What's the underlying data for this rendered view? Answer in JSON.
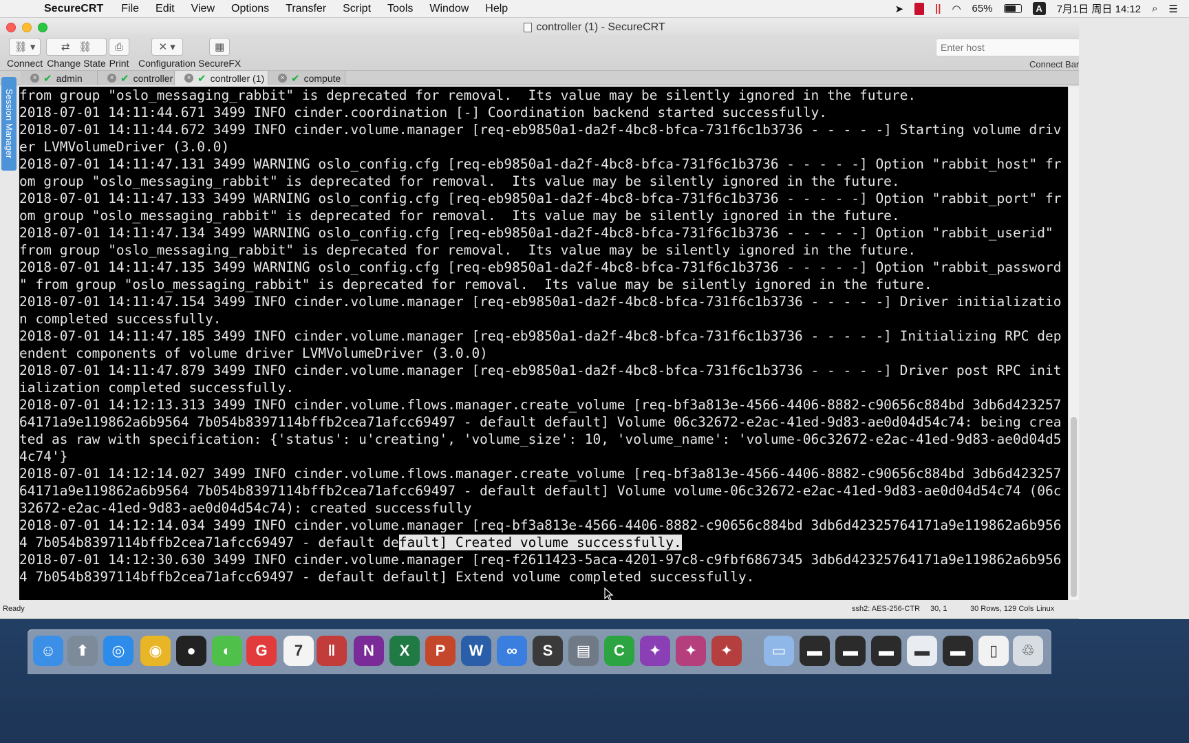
{
  "menubar": {
    "app_name": "SecureCRT",
    "items": [
      "File",
      "Edit",
      "View",
      "Options",
      "Transfer",
      "Script",
      "Tools",
      "Window",
      "Help"
    ],
    "battery": "65%",
    "ime": "A",
    "clock": "7月1日 周日 14:12"
  },
  "window": {
    "title": "controller (1) - SecureCRT"
  },
  "toolbar": {
    "connect": "Connect",
    "change_state": "Change State",
    "print": "Print",
    "configuration": "Configuration",
    "securefx": "SecureFX",
    "host_placeholder": "Enter host",
    "connect_bar": "Connect Bar"
  },
  "tabs": [
    {
      "label": "admin",
      "active": false
    },
    {
      "label": "controller",
      "active": false
    },
    {
      "label": "controller (1)",
      "active": true
    },
    {
      "label": "compute",
      "active": false
    }
  ],
  "session_manager": "Session Manager",
  "terminal": {
    "lines": [
      "from group \"oslo_messaging_rabbit\" is deprecated for removal.  Its value may be silently ignored in the future.",
      "2018-07-01 14:11:44.671 3499 INFO cinder.coordination [-] Coordination backend started successfully.",
      "2018-07-01 14:11:44.672 3499 INFO cinder.volume.manager [req-eb9850a1-da2f-4bc8-bfca-731f6c1b3736 - - - - -] Starting volume driv",
      "er LVMVolumeDriver (3.0.0)",
      "2018-07-01 14:11:47.131 3499 WARNING oslo_config.cfg [req-eb9850a1-da2f-4bc8-bfca-731f6c1b3736 - - - - -] Option \"rabbit_host\" fr",
      "om group \"oslo_messaging_rabbit\" is deprecated for removal.  Its value may be silently ignored in the future.",
      "2018-07-01 14:11:47.133 3499 WARNING oslo_config.cfg [req-eb9850a1-da2f-4bc8-bfca-731f6c1b3736 - - - - -] Option \"rabbit_port\" fr",
      "om group \"oslo_messaging_rabbit\" is deprecated for removal.  Its value may be silently ignored in the future.",
      "2018-07-01 14:11:47.134 3499 WARNING oslo_config.cfg [req-eb9850a1-da2f-4bc8-bfca-731f6c1b3736 - - - - -] Option \"rabbit_userid\"",
      "from group \"oslo_messaging_rabbit\" is deprecated for removal.  Its value may be silently ignored in the future.",
      "2018-07-01 14:11:47.135 3499 WARNING oslo_config.cfg [req-eb9850a1-da2f-4bc8-bfca-731f6c1b3736 - - - - -] Option \"rabbit_password",
      "\" from group \"oslo_messaging_rabbit\" is deprecated for removal.  Its value may be silently ignored in the future.",
      "2018-07-01 14:11:47.154 3499 INFO cinder.volume.manager [req-eb9850a1-da2f-4bc8-bfca-731f6c1b3736 - - - - -] Driver initializatio",
      "n completed successfully.",
      "2018-07-01 14:11:47.185 3499 INFO cinder.volume.manager [req-eb9850a1-da2f-4bc8-bfca-731f6c1b3736 - - - - -] Initializing RPC dep",
      "endent components of volume driver LVMVolumeDriver (3.0.0)",
      "2018-07-01 14:11:47.879 3499 INFO cinder.volume.manager [req-eb9850a1-da2f-4bc8-bfca-731f6c1b3736 - - - - -] Driver post RPC init",
      "ialization completed successfully.",
      "2018-07-01 14:12:13.313 3499 INFO cinder.volume.flows.manager.create_volume [req-bf3a813e-4566-4406-8882-c90656c884bd 3db6d423257",
      "64171a9e119862a6b9564 7b054b8397114bffb2cea71afcc69497 - default default] Volume 06c32672-e2ac-41ed-9d83-ae0d04d54c74: being crea",
      "ted as raw with specification: {'status': u'creating', 'volume_size': 10, 'volume_name': 'volume-06c32672-e2ac-41ed-9d83-ae0d04d5",
      "4c74'}",
      "2018-07-01 14:12:14.027 3499 INFO cinder.volume.flows.manager.create_volume [req-bf3a813e-4566-4406-8882-c90656c884bd 3db6d423257",
      "64171a9e119862a6b9564 7b054b8397114bffb2cea71afcc69497 - default default] Volume volume-06c32672-e2ac-41ed-9d83-ae0d04d54c74 (06c",
      "32672-e2ac-41ed-9d83-ae0d04d54c74): created successfully",
      "2018-07-01 14:12:14.034 3499 INFO cinder.volume.manager [req-bf3a813e-4566-4406-8882-c90656c884bd 3db6d42325764171a9e119862a6b956"
    ],
    "sel_line_pre": "4 7b054b8397114bffb2cea71afcc69497 - default de",
    "sel_line_sel": "fault] Created volume successfully.",
    "tail_lines": [
      "2018-07-01 14:12:30.630 3499 INFO cinder.volume.manager [req-f2611423-5aca-4201-97c8-c9fbf6867345 3db6d42325764171a9e119862a6b956",
      "4 7b054b8397114bffb2cea71afcc69497 - default default] Extend volume completed successfully."
    ]
  },
  "status": {
    "ready": "Ready",
    "cipher": "ssh2: AES-256-CTR",
    "position": "30, 1",
    "size": "30 Rows, 129 Cols",
    "term": "Linux"
  },
  "dock": {
    "apps": [
      {
        "name": "finder",
        "color": "#3b8fe6",
        "glyph": "☺"
      },
      {
        "name": "launchpad",
        "color": "#7d8a99",
        "glyph": "⬆"
      },
      {
        "name": "safari",
        "color": "#2d8bea",
        "glyph": "◎"
      },
      {
        "name": "chrome",
        "color": "#e8b526",
        "glyph": "◉"
      },
      {
        "name": "qq",
        "color": "#222222",
        "glyph": "●"
      },
      {
        "name": "wechat",
        "color": "#4fc14a",
        "glyph": "◐"
      },
      {
        "name": "g-app",
        "color": "#e23b3b",
        "glyph": "G"
      },
      {
        "name": "calendar",
        "color": "#f4f4f4",
        "glyph": "7"
      },
      {
        "name": "parallels",
        "color": "#c33c3c",
        "glyph": "‖"
      },
      {
        "name": "onenote",
        "color": "#7b2b97",
        "glyph": "N"
      },
      {
        "name": "excel",
        "color": "#1f7a44",
        "glyph": "X"
      },
      {
        "name": "powerpoint",
        "color": "#c4472b",
        "glyph": "P"
      },
      {
        "name": "word",
        "color": "#2b5ea8",
        "glyph": "W"
      },
      {
        "name": "baidu-netdisk",
        "color": "#3a7ee0",
        "glyph": "∞"
      },
      {
        "name": "sublime",
        "color": "#3a3a3a",
        "glyph": "S"
      },
      {
        "name": "securecrt",
        "color": "#707a86",
        "glyph": "▤"
      },
      {
        "name": "codeedit",
        "color": "#2ca441",
        "glyph": "C"
      },
      {
        "name": "puzzle-1",
        "color": "#8b3fb5",
        "glyph": "✦"
      },
      {
        "name": "puzzle-2",
        "color": "#b53f7c",
        "glyph": "✦"
      },
      {
        "name": "puzzle-3",
        "color": "#b53f3f",
        "glyph": "✦"
      },
      {
        "name": "folder",
        "color": "#8fb8e8",
        "glyph": "▭"
      },
      {
        "name": "window-1",
        "color": "#2b2b2b",
        "glyph": "▬"
      },
      {
        "name": "window-2",
        "color": "#2b2b2b",
        "glyph": "▬"
      },
      {
        "name": "window-3",
        "color": "#2b2b2b",
        "glyph": "▬"
      },
      {
        "name": "window-4",
        "color": "#e9edf2",
        "glyph": "▬"
      },
      {
        "name": "window-5",
        "color": "#2b2b2b",
        "glyph": "▬"
      },
      {
        "name": "blank-doc",
        "color": "#f2f2f2",
        "glyph": "▯"
      },
      {
        "name": "trash",
        "color": "#d8dde3",
        "glyph": "♲"
      }
    ]
  }
}
